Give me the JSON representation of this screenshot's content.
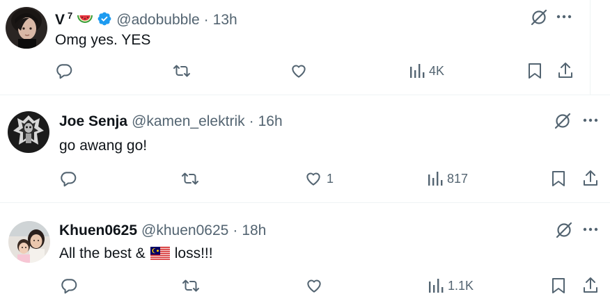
{
  "tweets": [
    {
      "name": "V",
      "name_sup": "7",
      "handle": "@adobubble",
      "dot": "·",
      "time": "13h",
      "text": "Omg yes. YES",
      "replies": "",
      "retweets": "",
      "likes": "",
      "views": "4K",
      "verified": true,
      "emoji": "watermelon"
    },
    {
      "name": "Joe Senja",
      "handle": "@kamen_elektrik",
      "dot": "·",
      "time": "16h",
      "text": "go awang go!",
      "replies": "",
      "retweets": "",
      "likes": "1",
      "views": "817"
    },
    {
      "name": "Khuen0625",
      "handle": "@khuen0625",
      "dot": "·",
      "time": "18h",
      "text_before": "All the best &",
      "text_after": "loss!!!",
      "text_flag": "malaysia-flag",
      "replies": "",
      "retweets": "",
      "likes": "",
      "views": "1.1K"
    }
  ],
  "colors": {
    "text": "#0f1419",
    "secondary": "#536471",
    "verified": "#1d9bf0",
    "divider": "#eff3f4"
  },
  "icons": [
    "reply-icon",
    "retweet-icon",
    "like-icon",
    "views-icon",
    "bookmark-icon",
    "share-icon",
    "grok-icon",
    "more-icon",
    "verified-icon"
  ]
}
